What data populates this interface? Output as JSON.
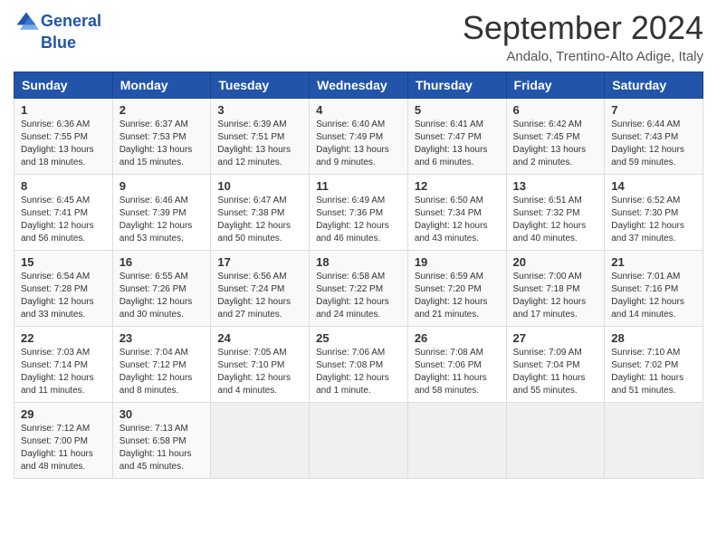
{
  "header": {
    "logo_line1": "General",
    "logo_line2": "Blue",
    "month": "September 2024",
    "location": "Andalo, Trentino-Alto Adige, Italy"
  },
  "weekdays": [
    "Sunday",
    "Monday",
    "Tuesday",
    "Wednesday",
    "Thursday",
    "Friday",
    "Saturday"
  ],
  "weeks": [
    [
      {
        "day": "1",
        "sunrise": "6:36 AM",
        "sunset": "7:55 PM",
        "daylight": "13 hours and 18 minutes."
      },
      {
        "day": "2",
        "sunrise": "6:37 AM",
        "sunset": "7:53 PM",
        "daylight": "13 hours and 15 minutes."
      },
      {
        "day": "3",
        "sunrise": "6:39 AM",
        "sunset": "7:51 PM",
        "daylight": "13 hours and 12 minutes."
      },
      {
        "day": "4",
        "sunrise": "6:40 AM",
        "sunset": "7:49 PM",
        "daylight": "13 hours and 9 minutes."
      },
      {
        "day": "5",
        "sunrise": "6:41 AM",
        "sunset": "7:47 PM",
        "daylight": "13 hours and 6 minutes."
      },
      {
        "day": "6",
        "sunrise": "6:42 AM",
        "sunset": "7:45 PM",
        "daylight": "13 hours and 2 minutes."
      },
      {
        "day": "7",
        "sunrise": "6:44 AM",
        "sunset": "7:43 PM",
        "daylight": "12 hours and 59 minutes."
      }
    ],
    [
      {
        "day": "8",
        "sunrise": "6:45 AM",
        "sunset": "7:41 PM",
        "daylight": "12 hours and 56 minutes."
      },
      {
        "day": "9",
        "sunrise": "6:46 AM",
        "sunset": "7:39 PM",
        "daylight": "12 hours and 53 minutes."
      },
      {
        "day": "10",
        "sunrise": "6:47 AM",
        "sunset": "7:38 PM",
        "daylight": "12 hours and 50 minutes."
      },
      {
        "day": "11",
        "sunrise": "6:49 AM",
        "sunset": "7:36 PM",
        "daylight": "12 hours and 46 minutes."
      },
      {
        "day": "12",
        "sunrise": "6:50 AM",
        "sunset": "7:34 PM",
        "daylight": "12 hours and 43 minutes."
      },
      {
        "day": "13",
        "sunrise": "6:51 AM",
        "sunset": "7:32 PM",
        "daylight": "12 hours and 40 minutes."
      },
      {
        "day": "14",
        "sunrise": "6:52 AM",
        "sunset": "7:30 PM",
        "daylight": "12 hours and 37 minutes."
      }
    ],
    [
      {
        "day": "15",
        "sunrise": "6:54 AM",
        "sunset": "7:28 PM",
        "daylight": "12 hours and 33 minutes."
      },
      {
        "day": "16",
        "sunrise": "6:55 AM",
        "sunset": "7:26 PM",
        "daylight": "12 hours and 30 minutes."
      },
      {
        "day": "17",
        "sunrise": "6:56 AM",
        "sunset": "7:24 PM",
        "daylight": "12 hours and 27 minutes."
      },
      {
        "day": "18",
        "sunrise": "6:58 AM",
        "sunset": "7:22 PM",
        "daylight": "12 hours and 24 minutes."
      },
      {
        "day": "19",
        "sunrise": "6:59 AM",
        "sunset": "7:20 PM",
        "daylight": "12 hours and 21 minutes."
      },
      {
        "day": "20",
        "sunrise": "7:00 AM",
        "sunset": "7:18 PM",
        "daylight": "12 hours and 17 minutes."
      },
      {
        "day": "21",
        "sunrise": "7:01 AM",
        "sunset": "7:16 PM",
        "daylight": "12 hours and 14 minutes."
      }
    ],
    [
      {
        "day": "22",
        "sunrise": "7:03 AM",
        "sunset": "7:14 PM",
        "daylight": "12 hours and 11 minutes."
      },
      {
        "day": "23",
        "sunrise": "7:04 AM",
        "sunset": "7:12 PM",
        "daylight": "12 hours and 8 minutes."
      },
      {
        "day": "24",
        "sunrise": "7:05 AM",
        "sunset": "7:10 PM",
        "daylight": "12 hours and 4 minutes."
      },
      {
        "day": "25",
        "sunrise": "7:06 AM",
        "sunset": "7:08 PM",
        "daylight": "12 hours and 1 minute."
      },
      {
        "day": "26",
        "sunrise": "7:08 AM",
        "sunset": "7:06 PM",
        "daylight": "11 hours and 58 minutes."
      },
      {
        "day": "27",
        "sunrise": "7:09 AM",
        "sunset": "7:04 PM",
        "daylight": "11 hours and 55 minutes."
      },
      {
        "day": "28",
        "sunrise": "7:10 AM",
        "sunset": "7:02 PM",
        "daylight": "11 hours and 51 minutes."
      }
    ],
    [
      {
        "day": "29",
        "sunrise": "7:12 AM",
        "sunset": "7:00 PM",
        "daylight": "11 hours and 48 minutes."
      },
      {
        "day": "30",
        "sunrise": "7:13 AM",
        "sunset": "6:58 PM",
        "daylight": "11 hours and 45 minutes."
      },
      null,
      null,
      null,
      null,
      null
    ]
  ]
}
